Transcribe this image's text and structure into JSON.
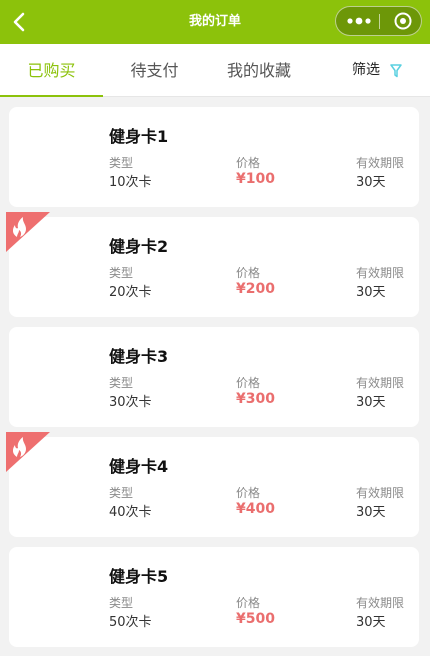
{
  "navbar": {
    "title": "我的订单",
    "icons": {
      "back": "chevron-left-icon",
      "more": "more-dots-icon",
      "close": "target-circle-icon"
    },
    "colors": {
      "brand": "#8cc20b"
    }
  },
  "tabs": [
    {
      "label": "已购买",
      "active": true
    },
    {
      "label": "待支付",
      "active": false
    },
    {
      "label": "我的收藏",
      "active": false
    }
  ],
  "filter": {
    "label": "筛选",
    "icon": "funnel-icon",
    "color": "#5ad0e0"
  },
  "cards": [
    {
      "title": "健身卡1",
      "type_label": "类型",
      "type_value": "10次卡",
      "price_label": "价格",
      "price": "¥100",
      "validity_label": "有效期限",
      "validity": "30天",
      "hot": false
    },
    {
      "title": "健身卡2",
      "type_label": "类型",
      "type_value": "20次卡",
      "price_label": "价格",
      "price": "¥200",
      "validity_label": "有效期限",
      "validity": "30天",
      "hot": true
    },
    {
      "title": "健身卡3",
      "type_label": "类型",
      "type_value": "30次卡",
      "price_label": "价格",
      "price": "¥300",
      "validity_label": "有效期限",
      "validity": "30天",
      "hot": false
    },
    {
      "title": "健身卡4",
      "type_label": "类型",
      "type_value": "40次卡",
      "price_label": "价格",
      "price": "¥400",
      "validity_label": "有效期限",
      "validity": "30天",
      "hot": true
    },
    {
      "title": "健身卡5",
      "type_label": "类型",
      "type_value": "50次卡",
      "price_label": "价格",
      "price": "¥500",
      "validity_label": "有效期限",
      "validity": "30天",
      "hot": false
    }
  ],
  "colors": {
    "price": "#ea6e6e",
    "hot_badge": "#ee6f6f"
  },
  "hot_badge_icon": "flame-icon"
}
